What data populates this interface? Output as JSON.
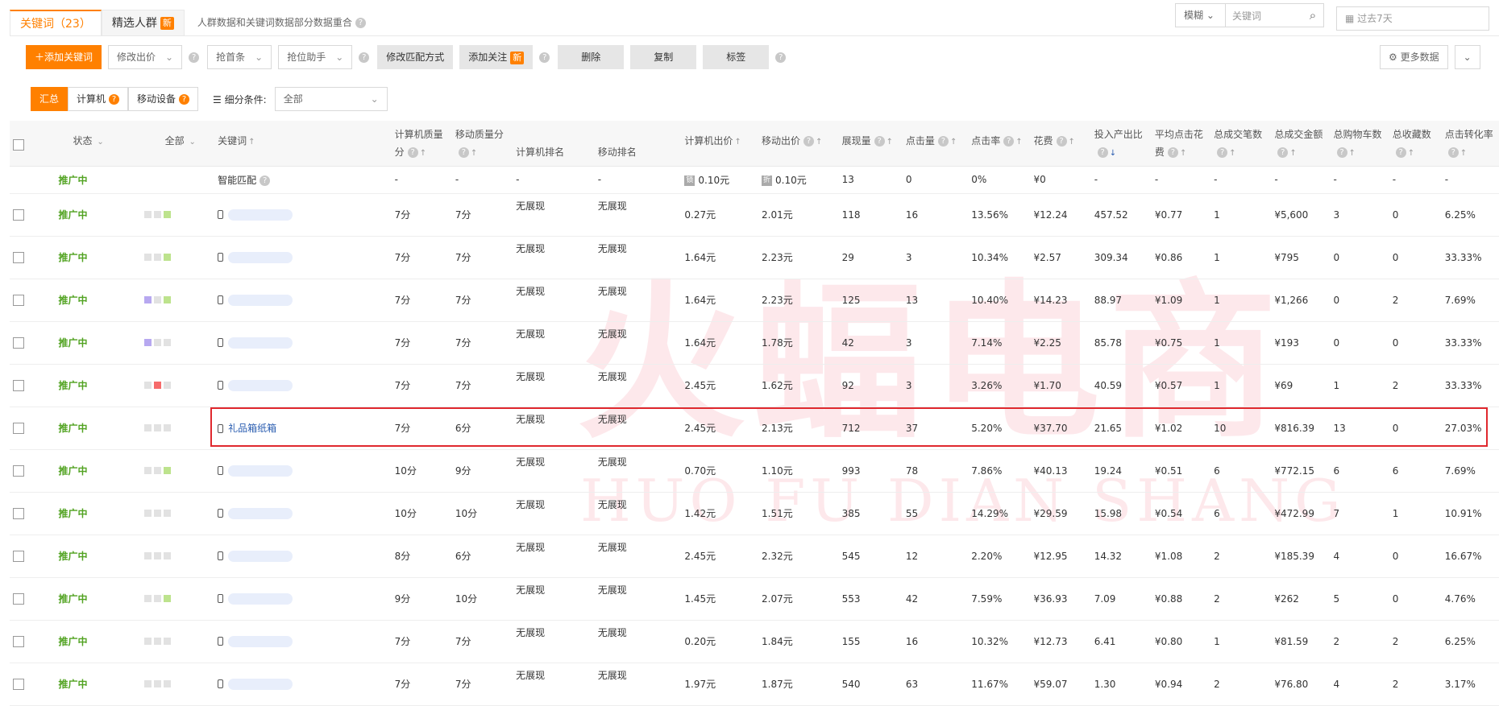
{
  "tabs": [
    {
      "label": "关键词（23）",
      "active": true
    },
    {
      "label": "精选人群",
      "badge": "新",
      "active": false
    }
  ],
  "tab_note": "人群数据和关键词数据部分数据重合",
  "search": {
    "mode": "模糊",
    "placeholder": "关键词"
  },
  "date_range": "过去7天",
  "toolbar": {
    "add_keyword": "添加关键词",
    "modify_bid": "修改出价",
    "grab_first": "抢首条",
    "rank_assistant": "抢位助手",
    "modify_match": "修改匹配方式",
    "add_follow": "添加关注",
    "add_follow_badge": "新",
    "delete": "删除",
    "copy": "复制",
    "tag": "标签",
    "more_data": "更多数据"
  },
  "segments": {
    "summary": "汇总",
    "computer": "计算机",
    "mobile": "移动设备"
  },
  "filter": {
    "label": "细分条件:",
    "value": "全部"
  },
  "columns": {
    "status": "状态",
    "all": "全部",
    "keyword": "关键词",
    "pc_quality": "计算机质量分",
    "mobile_quality": "移动质量分",
    "pc_rank": "计算机排名",
    "mobile_rank": "移动排名",
    "pc_bid": "计算机出价",
    "mobile_bid": "移动出价",
    "impressions": "展现量",
    "clicks": "点击量",
    "ctr": "点击率",
    "cost": "花费",
    "roi": "投入产出比",
    "cpc": "平均点击花费",
    "deals": "总成交笔数",
    "deal_amount": "总成交金额",
    "cart": "总购物车数",
    "fav": "总收藏数",
    "cvr": "点击转化率"
  },
  "smart_row": {
    "status": "推广中",
    "keyword": "智能匹配",
    "pc_quality": "-",
    "mobile_quality": "-",
    "pc_rank": "-",
    "mobile_rank": "-",
    "pc_bid_tag": "锁",
    "pc_bid": "0.10元",
    "mobile_bid_tag": "折",
    "mobile_bid": "0.10元",
    "impressions": "13",
    "clicks": "0",
    "ctr": "0%",
    "cost": "¥0",
    "roi": "-",
    "cpc": "-",
    "deals": "-",
    "deal_amount": "-",
    "cart": "-",
    "fav": "-",
    "cvr": "-"
  },
  "rows": [
    {
      "status": "推广中",
      "keyword": "",
      "pc_quality": "7分",
      "mobile_quality": "7分",
      "pc_rank": "无展现",
      "mobile_rank": "无展现",
      "pc_bid": "0.27元",
      "mobile_bid": "2.01元",
      "impressions": "118",
      "clicks": "16",
      "ctr": "13.56%",
      "cost": "¥12.24",
      "roi": "457.52",
      "cpc": "¥0.77",
      "deals": "1",
      "deal_amount": "¥5,600",
      "cart": "3",
      "fav": "0",
      "cvr": "6.25%"
    },
    {
      "status": "推广中",
      "keyword": "",
      "pc_quality": "7分",
      "mobile_quality": "7分",
      "pc_rank": "无展现",
      "mobile_rank": "无展现",
      "pc_bid": "1.64元",
      "mobile_bid": "2.23元",
      "impressions": "29",
      "clicks": "3",
      "ctr": "10.34%",
      "cost": "¥2.57",
      "roi": "309.34",
      "cpc": "¥0.86",
      "deals": "1",
      "deal_amount": "¥795",
      "cart": "0",
      "fav": "0",
      "cvr": "33.33%"
    },
    {
      "status": "推广中",
      "keyword": "",
      "pc_quality": "7分",
      "mobile_quality": "7分",
      "pc_rank": "无展现",
      "mobile_rank": "无展现",
      "pc_bid": "1.64元",
      "mobile_bid": "2.23元",
      "impressions": "125",
      "clicks": "13",
      "ctr": "10.40%",
      "cost": "¥14.23",
      "roi": "88.97",
      "cpc": "¥1.09",
      "deals": "1",
      "deal_amount": "¥1,266",
      "cart": "0",
      "fav": "2",
      "cvr": "7.69%"
    },
    {
      "status": "推广中",
      "keyword": "",
      "pc_quality": "7分",
      "mobile_quality": "7分",
      "pc_rank": "无展现",
      "mobile_rank": "无展现",
      "pc_bid": "1.64元",
      "mobile_bid": "1.78元",
      "impressions": "42",
      "clicks": "3",
      "ctr": "7.14%",
      "cost": "¥2.25",
      "roi": "85.78",
      "cpc": "¥0.75",
      "deals": "1",
      "deal_amount": "¥193",
      "cart": "0",
      "fav": "0",
      "cvr": "33.33%"
    },
    {
      "status": "推广中",
      "keyword": "",
      "pc_quality": "7分",
      "mobile_quality": "7分",
      "pc_rank": "无展现",
      "mobile_rank": "无展现",
      "pc_bid": "2.45元",
      "mobile_bid": "1.62元",
      "impressions": "92",
      "clicks": "3",
      "ctr": "3.26%",
      "cost": "¥1.70",
      "roi": "40.59",
      "cpc": "¥0.57",
      "deals": "1",
      "deal_amount": "¥69",
      "cart": "1",
      "fav": "2",
      "cvr": "33.33%"
    },
    {
      "status": "推广中",
      "keyword": "礼品箱纸箱",
      "pc_quality": "7分",
      "mobile_quality": "6分",
      "pc_rank": "无展现",
      "mobile_rank": "无展现",
      "pc_bid": "2.45元",
      "mobile_bid": "2.13元",
      "impressions": "712",
      "clicks": "37",
      "ctr": "5.20%",
      "cost": "¥37.70",
      "roi": "21.65",
      "cpc": "¥1.02",
      "deals": "10",
      "deal_amount": "¥816.39",
      "cart": "13",
      "fav": "0",
      "cvr": "27.03%"
    },
    {
      "status": "推广中",
      "keyword": "",
      "pc_quality": "10分",
      "mobile_quality": "9分",
      "pc_rank": "无展现",
      "mobile_rank": "无展现",
      "pc_bid": "0.70元",
      "mobile_bid": "1.10元",
      "impressions": "993",
      "clicks": "78",
      "ctr": "7.86%",
      "cost": "¥40.13",
      "roi": "19.24",
      "cpc": "¥0.51",
      "deals": "6",
      "deal_amount": "¥772.15",
      "cart": "6",
      "fav": "6",
      "cvr": "7.69%"
    },
    {
      "status": "推广中",
      "keyword": "",
      "pc_quality": "10分",
      "mobile_quality": "10分",
      "pc_rank": "无展现",
      "mobile_rank": "无展现",
      "pc_bid": "1.42元",
      "mobile_bid": "1.51元",
      "impressions": "385",
      "clicks": "55",
      "ctr": "14.29%",
      "cost": "¥29.59",
      "roi": "15.98",
      "cpc": "¥0.54",
      "deals": "6",
      "deal_amount": "¥472.99",
      "cart": "7",
      "fav": "1",
      "cvr": "10.91%"
    },
    {
      "status": "推广中",
      "keyword": "",
      "pc_quality": "8分",
      "mobile_quality": "6分",
      "pc_rank": "无展现",
      "mobile_rank": "无展现",
      "pc_bid": "2.45元",
      "mobile_bid": "2.32元",
      "impressions": "545",
      "clicks": "12",
      "ctr": "2.20%",
      "cost": "¥12.95",
      "roi": "14.32",
      "cpc": "¥1.08",
      "deals": "2",
      "deal_amount": "¥185.39",
      "cart": "4",
      "fav": "0",
      "cvr": "16.67%"
    },
    {
      "status": "推广中",
      "keyword": "",
      "pc_quality": "9分",
      "mobile_quality": "10分",
      "pc_rank": "无展现",
      "mobile_rank": "无展现",
      "pc_bid": "1.45元",
      "mobile_bid": "2.07元",
      "impressions": "553",
      "clicks": "42",
      "ctr": "7.59%",
      "cost": "¥36.93",
      "roi": "7.09",
      "cpc": "¥0.88",
      "deals": "2",
      "deal_amount": "¥262",
      "cart": "5",
      "fav": "0",
      "cvr": "4.76%"
    },
    {
      "status": "推广中",
      "keyword": "",
      "pc_quality": "7分",
      "mobile_quality": "7分",
      "pc_rank": "无展现",
      "mobile_rank": "无展现",
      "pc_bid": "0.20元",
      "mobile_bid": "1.84元",
      "impressions": "155",
      "clicks": "16",
      "ctr": "10.32%",
      "cost": "¥12.73",
      "roi": "6.41",
      "cpc": "¥0.80",
      "deals": "1",
      "deal_amount": "¥81.59",
      "cart": "2",
      "fav": "2",
      "cvr": "6.25%"
    },
    {
      "status": "推广中",
      "keyword": "",
      "pc_quality": "7分",
      "mobile_quality": "7分",
      "pc_rank": "无展现",
      "mobile_rank": "无展现",
      "pc_bid": "1.97元",
      "mobile_bid": "1.87元",
      "impressions": "540",
      "clicks": "63",
      "ctr": "11.67%",
      "cost": "¥59.07",
      "roi": "1.30",
      "cpc": "¥0.94",
      "deals": "2",
      "deal_amount": "¥76.80",
      "cart": "4",
      "fav": "2",
      "cvr": "3.17%"
    }
  ],
  "row_marks": [
    [
      "gray",
      "gray",
      "green"
    ],
    [
      "gray",
      "gray",
      "green"
    ],
    [
      "purple",
      "gray",
      "green"
    ],
    [
      "purple",
      "gray",
      "gray"
    ],
    [
      "gray",
      "red",
      "gray"
    ],
    [
      "gray",
      "gray",
      "gray"
    ],
    [
      "gray",
      "gray",
      "green"
    ],
    [
      "gray",
      "gray",
      "gray"
    ],
    [
      "gray",
      "gray",
      "gray"
    ],
    [
      "gray",
      "gray",
      "green"
    ],
    [
      "gray",
      "gray",
      "gray"
    ],
    [
      "gray",
      "gray",
      "gray"
    ]
  ],
  "watermark": {
    "main": "火蝠电商",
    "sub": "HUO FU DIAN SHANG"
  }
}
